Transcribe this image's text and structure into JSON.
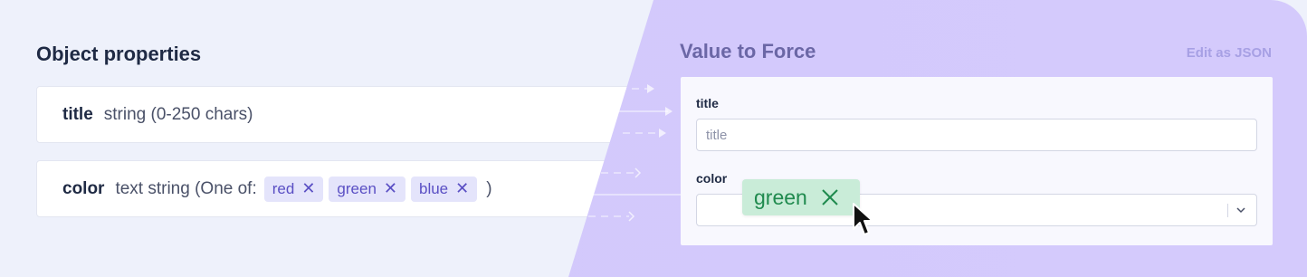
{
  "left": {
    "title": "Object properties",
    "properties": [
      {
        "name": "title",
        "type": "string (0-250 chars)"
      },
      {
        "name": "color",
        "type": "text string (One of:",
        "chips": [
          "red",
          "green",
          "blue"
        ],
        "suffix": ")"
      }
    ]
  },
  "right": {
    "title": "Value to Force",
    "edit_json": "Edit as JSON",
    "fields": {
      "title_label": "title",
      "title_placeholder": "title",
      "color_label": "color"
    },
    "dragged_chip": "green"
  },
  "colors": {
    "panel_purple": "#d4cafc",
    "chip_purple": "#e4e4fb",
    "chip_green": "#c9ecd8",
    "text_green": "#1f8a4e"
  },
  "icons": [
    "close-icon",
    "chevron-down-icon",
    "arrow-right-icon",
    "mouse-cursor-icon"
  ]
}
